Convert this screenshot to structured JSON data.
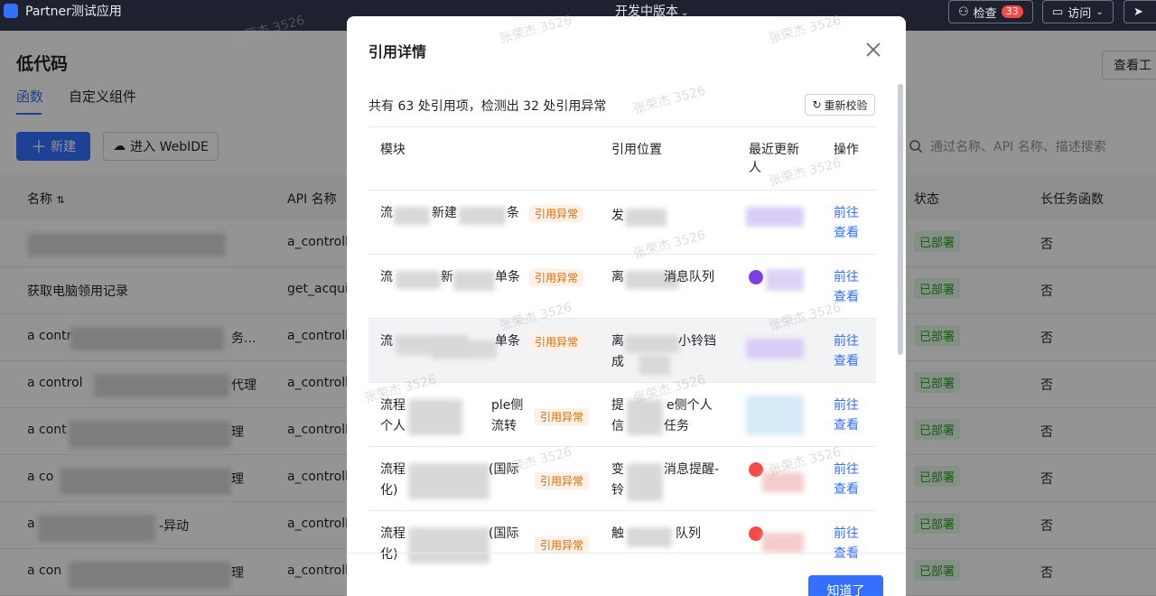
{
  "topbar": {
    "app_title": "Partner测试应用",
    "env_label": "开发中版本",
    "check_label": "检查",
    "check_count": "33",
    "visit_label": "访问"
  },
  "page": {
    "title": "低代码",
    "tabs": [
      "函数",
      "自定义组件"
    ],
    "new_button": "新建",
    "webide_button": "进入 WebIDE",
    "view_button": "查看工",
    "search_placeholder": "通过名称、API 名称、描述搜索",
    "columns": {
      "name": "名称",
      "api": "API 名称",
      "status": "状态",
      "long_task": "长任务函数"
    },
    "rows": [
      {
        "name": "",
        "api": "a_controll",
        "status": "已部署",
        "long_task": "否"
      },
      {
        "name": "获取电脑领用记录",
        "api": "get_acqui",
        "status": "已部署",
        "long_task": "否"
      },
      {
        "name": "a contr",
        "name_suffix": "务...",
        "api": "a_controll",
        "status": "已部署",
        "long_task": "否"
      },
      {
        "name": "a control",
        "name_suffix": "代理",
        "api": "a_controll",
        "status": "已部署",
        "long_task": "否"
      },
      {
        "name": "a cont",
        "name_suffix": "理",
        "api": "a_controll",
        "status": "已部署",
        "long_task": "否"
      },
      {
        "name": "a co",
        "name_suffix": "理",
        "api": "a_controll",
        "status": "已部署",
        "long_task": "否"
      },
      {
        "name": "a",
        "name_suffix": "-异动",
        "api": "a_controll",
        "status": "已部署",
        "long_task": "否"
      },
      {
        "name": "a con",
        "name_suffix": "理",
        "api": "a_controll",
        "status": "已部署",
        "long_task": "否"
      }
    ]
  },
  "modal": {
    "title": "引用详情",
    "summary": "共有 63 处引用项，检测出 32 处引用异常",
    "recheck_label": "重新校验",
    "columns": {
      "module": "模块",
      "location": "引用位置",
      "updater_line1": "最近更新",
      "updater_line2": "人",
      "action": "操作"
    },
    "error_tag": "引用异常",
    "action_goto": "前往",
    "action_view": "查看",
    "rows": [
      {
        "module_a": "流",
        "module_b": "新建",
        "module_c": "条",
        "location_a": "发",
        "location_b": ""
      },
      {
        "module_a": "流",
        "module_b": "新",
        "module_c": "单条",
        "location_a": "离",
        "location_b": "消息队列"
      },
      {
        "module_a": "流",
        "module_b": "",
        "module_c": "单条",
        "location_a": "离",
        "location_b": "小铃铛",
        "location_c": "成"
      },
      {
        "module_a": "流程",
        "module_b": "ple侧",
        "module_c": "个人",
        "module_d": "流转",
        "location_a": "提",
        "location_b": "e侧个人",
        "location_c": "信",
        "location_d": "任务"
      },
      {
        "module_a": "流程",
        "module_b": "(国际",
        "module_c": "化)",
        "location_a": "变",
        "location_b": "消息提醒-",
        "location_c": "铃"
      },
      {
        "module_a": "流程",
        "module_b": "(国际",
        "module_c": "化)",
        "location_a": "触",
        "location_b": "队列"
      }
    ],
    "ok_button": "知道了"
  },
  "watermark": "张荣杰 3526",
  "colors": {
    "primary": "#3370ff",
    "success_bg": "#e4f7e8",
    "success_text": "#2ea121",
    "warn_bg": "#fff1e8",
    "warn_text": "#d46b08"
  }
}
